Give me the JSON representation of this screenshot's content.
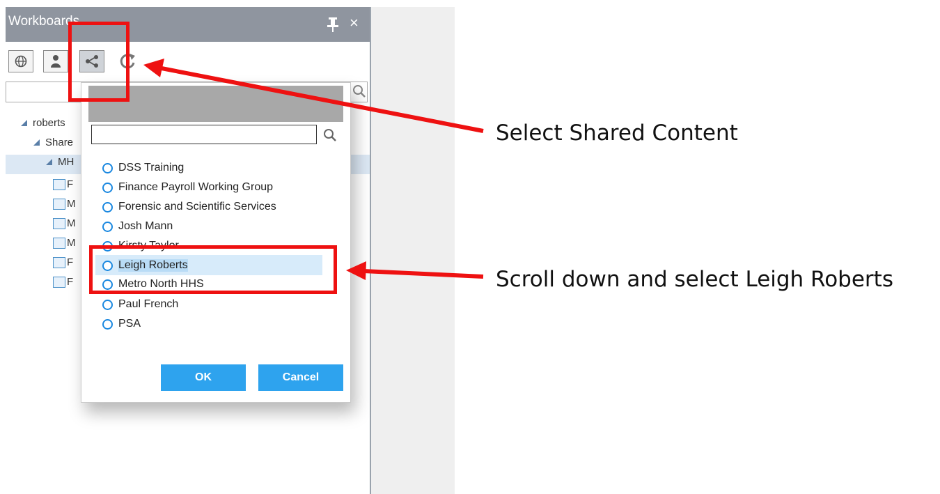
{
  "panel": {
    "title": "Workboards",
    "close_glyph": "×",
    "toolbar": [
      "globe-icon",
      "user-icon",
      "share-icon",
      "refresh-icon"
    ],
    "tree": [
      {
        "label": "roberts"
      },
      {
        "label": "Share"
      },
      {
        "label": "MH"
      }
    ],
    "tree_items": [
      "F",
      "M",
      "M",
      "M",
      "F",
      "F"
    ]
  },
  "dialog": {
    "search_value": "",
    "options": [
      {
        "label": "DSS Training",
        "selected": false
      },
      {
        "label": "Finance Payroll Working Group",
        "selected": false
      },
      {
        "label": "Forensic and Scientific Services",
        "selected": false
      },
      {
        "label": "Josh Mann",
        "selected": false
      },
      {
        "label": "Kirsty Taylor",
        "selected": false
      },
      {
        "label": "Leigh Roberts",
        "selected": true
      },
      {
        "label": "Metro North HHS",
        "selected": false
      },
      {
        "label": "Paul French",
        "selected": false
      },
      {
        "label": "PSA",
        "selected": false
      }
    ],
    "ok_label": "OK",
    "cancel_label": "Cancel"
  },
  "annotations": {
    "callout_1": "Select Shared Content",
    "callout_2": "Scroll down and select Leigh Roberts",
    "color": "#ee1111"
  },
  "colors": {
    "titlebar": "#8f959f",
    "button_blue": "#2ea3ee",
    "selection": "#d7ebfa"
  }
}
